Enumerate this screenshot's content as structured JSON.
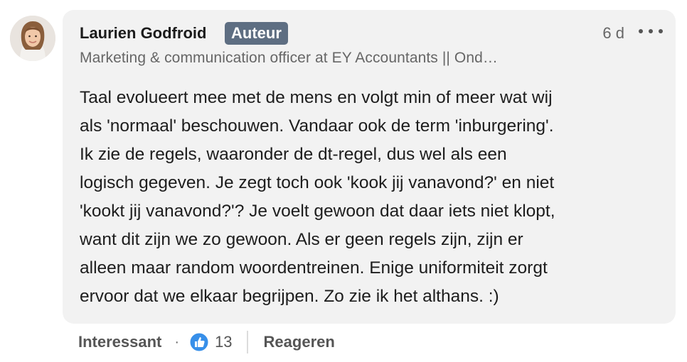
{
  "comment": {
    "author": "Laurien Godfroid",
    "badge": "Auteur",
    "time": "6 d",
    "headline": "Marketing & communication officer at EY Accountants || Ond…",
    "body_lines": [
      "Taal evolueert mee met de mens en volgt min of meer wat wij",
      "als 'normaal' beschouwen. Vandaar ook de term 'inburgering'.",
      "Ik zie de regels, waaronder de dt-regel, dus wel als een",
      "logisch gegeven. Je zegt toch ook 'kook jij vanavond?' en niet",
      "'kookt jij vanavond?'? Je voelt gewoon dat daar iets niet klopt,",
      "want dit zijn we zo gewoon. Als er geen regels zijn, zijn er",
      "alleen maar random woordentreinen. Enige uniformiteit zorgt",
      "ervoor dat we elkaar begrijpen. Zo zie ik het althans. :)"
    ]
  },
  "actions": {
    "reaction_label": "Interessant",
    "separator": "·",
    "reaction_count": "13",
    "reply_label": "Reageren"
  },
  "icons": {
    "more": "more-horizontal-icon",
    "reaction": "like-icon"
  },
  "colors": {
    "badge_bg": "#5e6e82",
    "bubble_bg": "#f2f2f2",
    "like_blue": "#378fe9"
  }
}
